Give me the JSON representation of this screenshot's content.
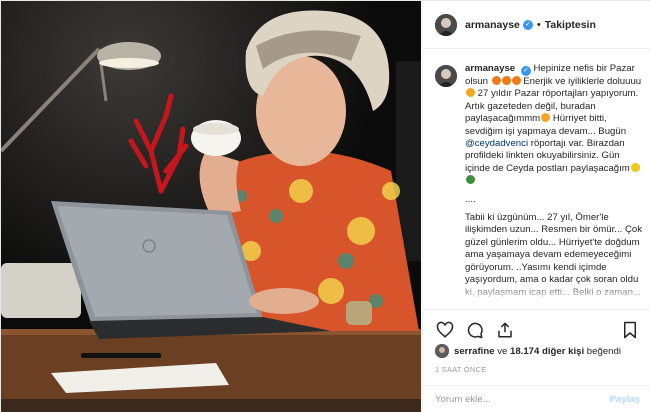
{
  "post": {
    "username": "armanayse",
    "separator": "•",
    "follow_label": "Takiptesin",
    "caption_user": "armanayse",
    "caption_lines": [
      "Hepinize nefis bir Pazar olsun",
      "Enerjik ve iyiliklerle doluuuu",
      "27 yıldır Pazar röportajları yapıyorum. Artık gazeteden değil, buradan paylaşacağımmm",
      "Hürriyet bitti, sevdiğim işi yapmaya devam... Bugün",
      "@ceydadvenci",
      "röportajı var. Birazdan profildeki linkten okuyabilirsiniz. Gün içinde de Ceyda postları paylaşacağım",
      "....",
      "Tabii ki üzgünüm... 27 yıl, Ömer'le ilişkimden uzun... Resmen bir ömür... Çok güzel günlerim oldu... Hürriyet'te doğdum ama yaşamaya devam edemeyeceğimi görüyorum. ..Yasımı kendi içimde yaşıyordum, ama o kadar çok soran oldu ki, paylaşmam icap etti... Belki o zaman... Sonra hafta"
    ],
    "likes_user": "serrafine",
    "likes_mid": " ve ",
    "likes_count": "18.174 diğer kişi",
    "likes_suffix": " beğendi",
    "timestamp": "1 SAAT ÖNCE",
    "comment_placeholder": "Yorum ekle...",
    "post_button": "Paylaş"
  },
  "icons": {
    "like": "heart-icon",
    "comment": "comment-icon",
    "share": "share-icon",
    "save": "bookmark-icon",
    "verified": "verified-badge-icon"
  },
  "colors": {
    "verified": "#3897f0",
    "mention": "#003569",
    "post_disabled": "#b3dbff",
    "muted": "#999999"
  }
}
